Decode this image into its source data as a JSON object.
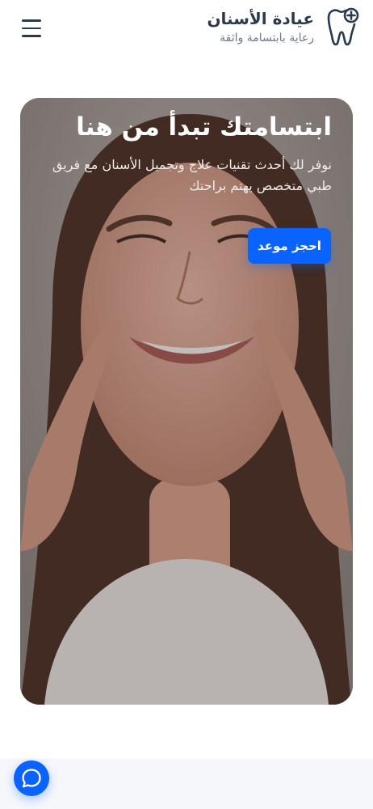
{
  "header": {
    "brand_title": "عيادة الأسنان",
    "brand_subtitle": "رعاية بابتسامة واثقة",
    "logo_icon": "tooth-plus-icon",
    "menu_icon": "hamburger-menu-icon"
  },
  "hero": {
    "title": "ابتسامتك تبدأ من هنا",
    "description": "نوفر لك أحدث تقنيات علاج وتجميل الأسنان مع فريق طبي متخصص يهتم براحتك",
    "cta_label": "احجز موعد",
    "image": "smiling-woman-photo"
  },
  "chat": {
    "icon": "chat-bubble-icon"
  },
  "colors": {
    "primary": "#0a63ff",
    "heading": "#2a3a4d",
    "muted": "#6c7a8a"
  }
}
